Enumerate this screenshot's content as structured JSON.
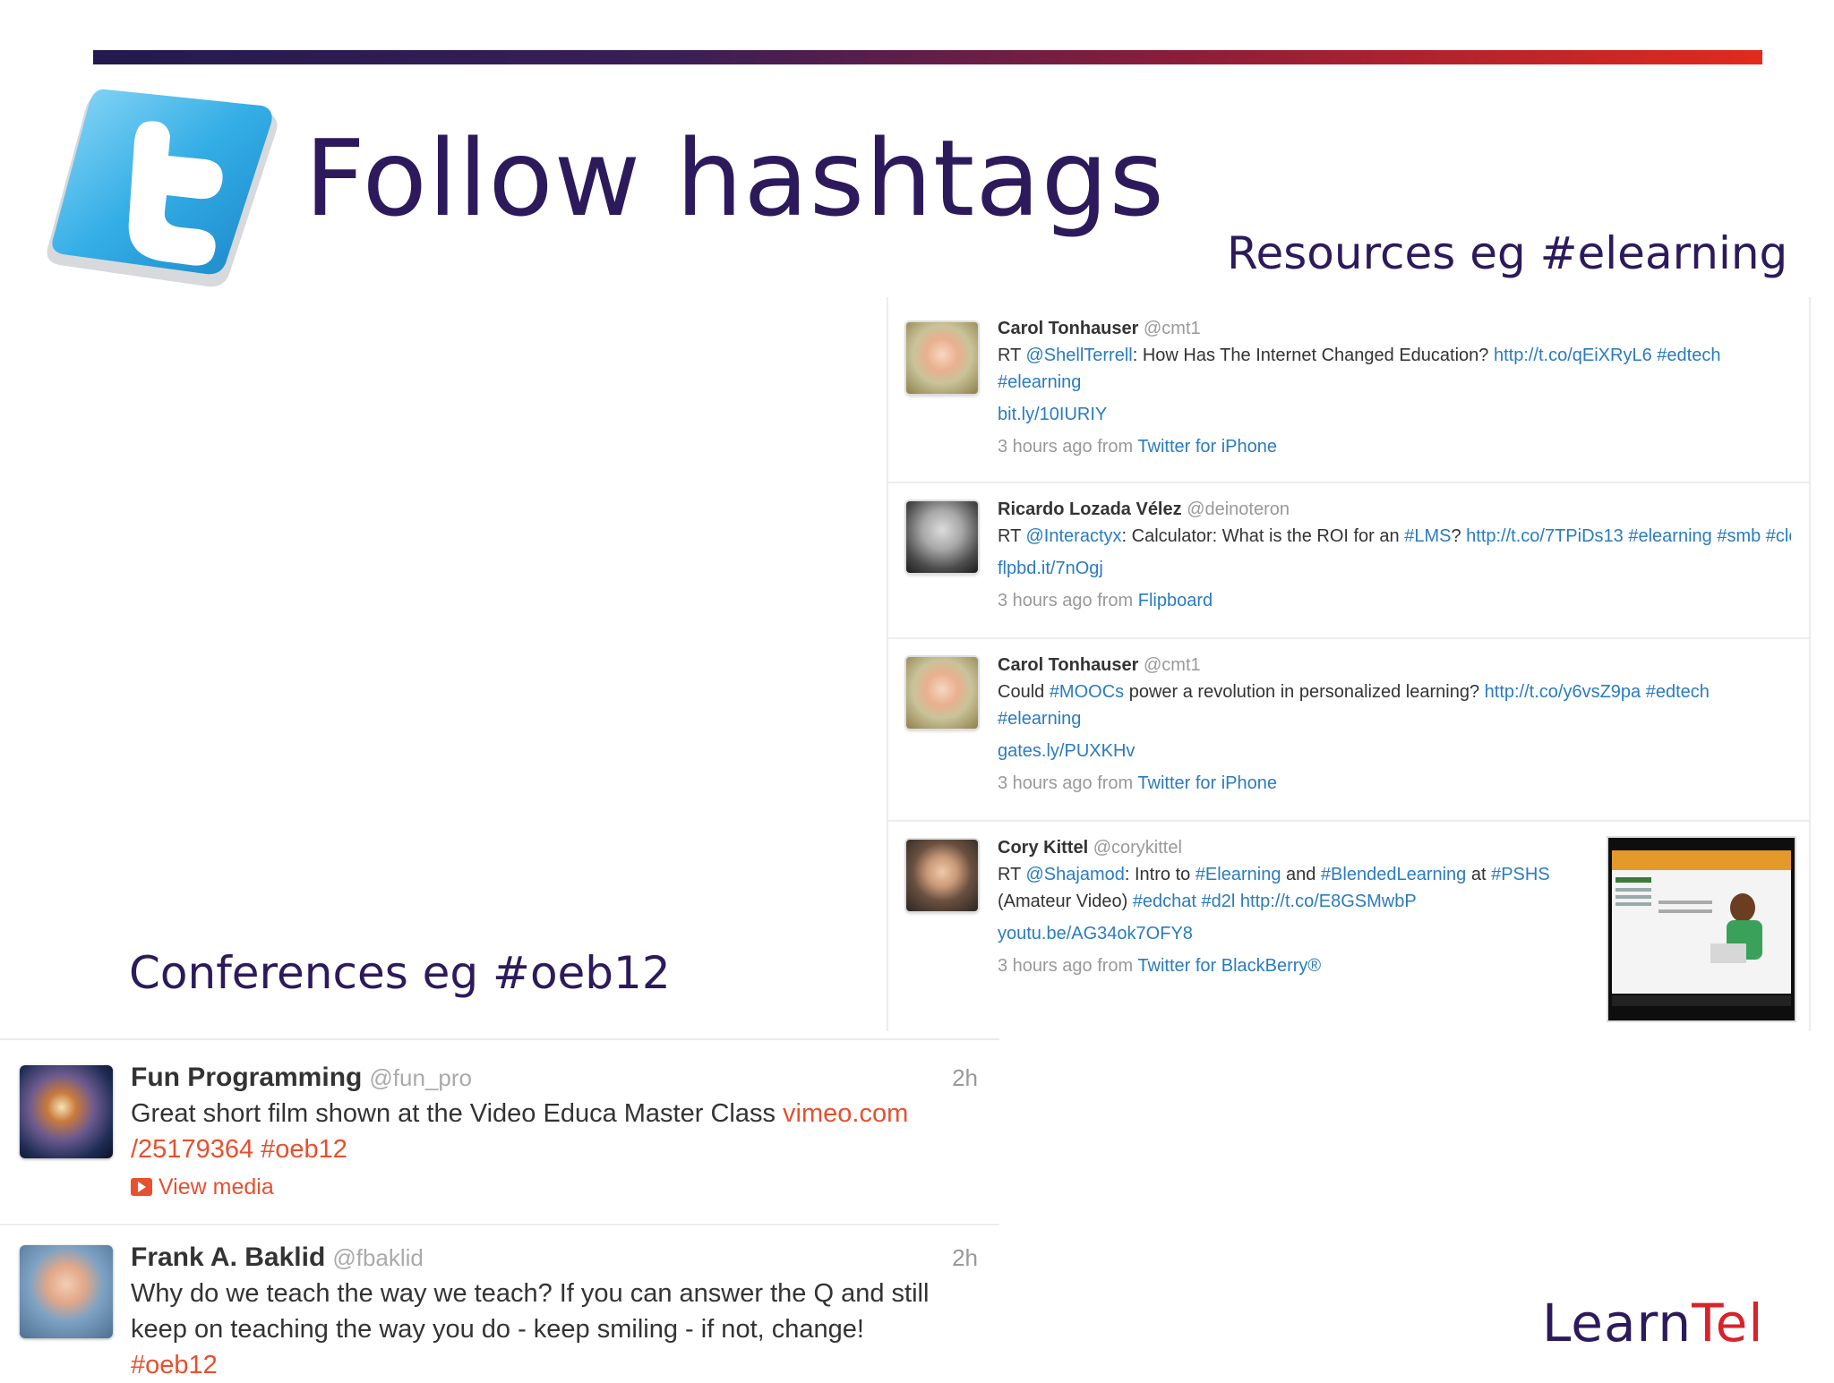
{
  "slide": {
    "title": "Follow hashtags",
    "caption_resources": "Resources eg #elearning",
    "caption_conferences": "Conferences eg #oeb12",
    "brand_learn": "Learn",
    "brand_tel": "Tel"
  },
  "colors": {
    "title": "#2c1a5c",
    "link": "#2a7bc0",
    "accent_orange": "#e8502e",
    "brand_red": "#d8232a"
  },
  "resources_tweets": [
    {
      "name": "Carol Tonhauser",
      "handle": "@cmt1",
      "text1_prefix": "RT ",
      "mention": "@ShellTerrell",
      "text1_mid": ": How Has The Internet Changed Education? ",
      "url": "http://t.co/qEiXRyL6",
      "tag1": "#edtech",
      "tag2": "#elearning",
      "short_link": "bit.ly/10IURIY",
      "time": "3 hours ago from ",
      "source": "Twitter for iPhone",
      "avatar_icon": "avatar-icon"
    },
    {
      "name": "Ricardo Lozada Vélez",
      "handle": "@deinoteron",
      "text1_prefix": "RT ",
      "mention": "@Interactyx",
      "text1_mid": ": Calculator: What is the ROI for an ",
      "tag_lms": "#LMS",
      "q": "? ",
      "url": "http://t.co/7TPiDs13",
      "tag1": "#elearning",
      "tag2": "#smb",
      "tag3": "#clo",
      "short_link": "flpbd.it/7nOgj",
      "time": "3 hours ago from ",
      "source": "Flipboard"
    },
    {
      "name": "Carol Tonhauser",
      "handle": "@cmt1",
      "text1_prefix": "Could ",
      "tag_moocs": "#MOOCs",
      "text1_mid": " power a revolution in personalized learning? ",
      "url": "http://t.co/y6vsZ9pa",
      "tag1": "#edtech",
      "tag2": "#elearning",
      "short_link": "gates.ly/PUXKHv",
      "time": "3 hours ago from ",
      "source": "Twitter for iPhone"
    },
    {
      "name": "Cory Kittel",
      "handle": "@corykittel",
      "text1_prefix": "RT ",
      "mention": "@Shajamod",
      "text1_mid": ": Intro to ",
      "tag_elearning": "#Elearning",
      "and": " and ",
      "tag_blended": "#BlendedLearning",
      "at": " at ",
      "tag_pshs": "#PSHS",
      "text2_prefix": "(Amateur Video) ",
      "tag_edchat": "#edchat",
      "tag_d2l": "#d2l",
      "url": "http://t.co/E8GSMwbP",
      "short_link": "youtu.be/AG34ok7OFY8",
      "time": "3 hours ago from ",
      "source": "Twitter for BlackBerry®"
    }
  ],
  "conference_tweets": [
    {
      "name": "Fun Programming",
      "handle": "@fun_pro",
      "time": "2h",
      "text": "Great short film shown at the Video Educa Master Class ",
      "link1": "vimeo.com",
      "link2": "/25179364",
      "tag": "#oeb12",
      "media": "View media"
    },
    {
      "name": "Frank A. Baklid",
      "handle": "@fbaklid",
      "time": "2h",
      "line1": "Why do we teach the way we teach? If you can answer the Q and still",
      "line2": "keep on teaching the way you do - keep smiling - if not, change!",
      "tag": "#oeb12"
    }
  ]
}
